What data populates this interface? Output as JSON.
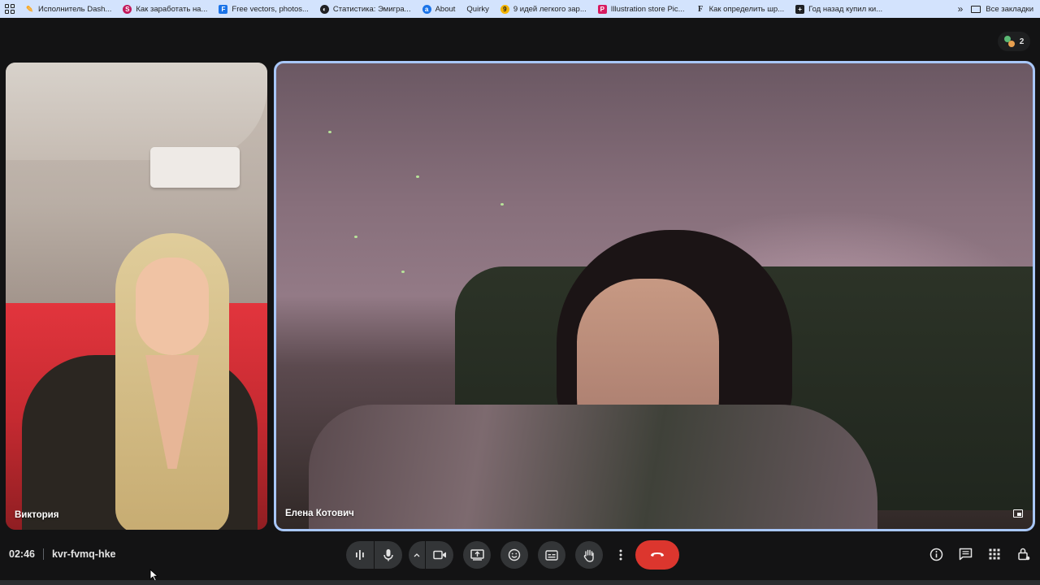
{
  "bookmarks": {
    "items": [
      {
        "label": "Исполнитель Dash...",
        "icon": "pen-icon",
        "color": "#f9a825"
      },
      {
        "label": "Как заработать на...",
        "icon": "s-logo-icon",
        "color": "#c2185b"
      },
      {
        "label": "Free vectors, photos...",
        "icon": "f-logo-icon",
        "color": "#1a73e8"
      },
      {
        "label": "Статистика: Эмигра...",
        "icon": "globe-icon",
        "color": "#202124"
      },
      {
        "label": "About",
        "icon": "about-logo-icon",
        "color": "#1a73e8"
      },
      {
        "label": "Quirky",
        "icon": "",
        "color": ""
      },
      {
        "label": "9 идей легкого зар...",
        "icon": "yellow-circle-icon",
        "color": "#f4b400"
      },
      {
        "label": "Illustration store Pic...",
        "icon": "pic-logo-icon",
        "color": "#d81b60"
      },
      {
        "label": "Как определить шр...",
        "icon": "f-text-icon",
        "color": "#202124"
      },
      {
        "label": "Год назад купил ки...",
        "icon": "plus-square-icon",
        "color": "#202124"
      }
    ],
    "more_label": "»",
    "folder_label": "Все закладки"
  },
  "participants": {
    "count": "2"
  },
  "tiles": {
    "left": {
      "name": "Виктория"
    },
    "right": {
      "name": "Елена Котович"
    }
  },
  "meeting": {
    "time": "02:46",
    "code": "kvr-fvmq-hke"
  },
  "controls": [
    {
      "name": "audio-levels-icon"
    },
    {
      "name": "microphone-icon"
    },
    {
      "name": "chevron-up-icon"
    },
    {
      "name": "camera-icon"
    },
    {
      "name": "present-screen-icon"
    },
    {
      "name": "emoji-icon"
    },
    {
      "name": "captions-icon"
    },
    {
      "name": "raise-hand-icon"
    },
    {
      "name": "more-vert-icon"
    },
    {
      "name": "end-call-icon"
    }
  ],
  "right_controls": [
    {
      "name": "info-icon"
    },
    {
      "name": "chat-icon"
    },
    {
      "name": "activities-grid-icon"
    },
    {
      "name": "host-controls-icon"
    }
  ],
  "colors": {
    "active_speaker_border": "#a8c7fa",
    "end_call": "#dc362e",
    "background": "#131314",
    "bookmarks_bar": "#d3e3fd"
  }
}
